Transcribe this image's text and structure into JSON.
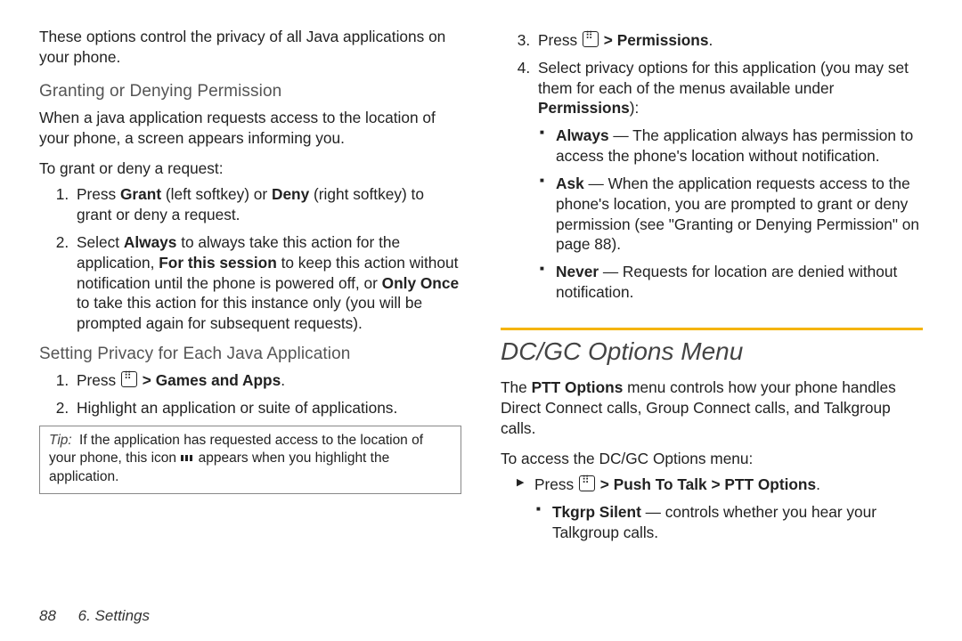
{
  "left": {
    "intro": "These options control the privacy of all Java applications on your phone.",
    "h_grant": "Granting or Denying Permission",
    "grant_body": "When a java application requests access to the location of your phone, a screen appears informing you.",
    "grant_lead": "To grant or deny a request:",
    "step1_a": "Press ",
    "step1_grant": "Grant",
    "step1_b": " (left softkey) or ",
    "step1_deny": "Deny",
    "step1_c": " (right softkey) to grant or deny a request.",
    "step2_a": "Select ",
    "step2_always": "Always",
    "step2_b": " to always take this action for the application, ",
    "step2_sess": "For this session",
    "step2_c": " to keep this action without notification until the phone is powered off, or ",
    "step2_once": "Only Once",
    "step2_d": " to take this action for this instance only (you will be prompted again for subsequent requests).",
    "h_priv": "Setting Privacy for Each Java Application",
    "priv1_a": "Press ",
    "priv1_path": "Games and Apps",
    "priv1_gt": " > ",
    "priv1_dot": ".",
    "priv2": "Highlight an application or suite of applications.",
    "tip_label": "Tip:",
    "tip_a": "If the application has requested access to the location of your phone, this icon ",
    "tip_b": " appears when you highlight the application."
  },
  "right": {
    "r3_a": "Press ",
    "r3_gt": " > ",
    "r3_perm": "Permissions",
    "r3_dot": ".",
    "r4_a": "Select privacy options for this application (you may set them for each of the menus available under ",
    "r4_perm": "Permissions",
    "r4_b": "):",
    "opt_always_l": "Always",
    "opt_always_t": " — The application always has permission to access the phone's location without notification.",
    "opt_ask_l": "Ask",
    "opt_ask_t": " — When the application requests access to the phone's location, you are prompted to grant or deny permission (see \"Granting or Denying Permission\" on page 88).",
    "opt_never_l": "Never",
    "opt_never_t": " — Requests for location are denied without notification.",
    "section": "DC/GC Options Menu",
    "dc_intro_a": "The ",
    "dc_intro_b": "PTT Options",
    "dc_intro_c": " menu controls how your phone handles Direct Connect calls, Group Connect calls, and Talkgroup calls.",
    "dc_lead": "To access the DC/GC Options menu:",
    "dc_press_a": "Press ",
    "dc_gt1": " > ",
    "dc_ptt": "Push To Talk",
    "dc_gt2": " > ",
    "dc_pttopt": "PTT Options",
    "dc_dot": ".",
    "dc_tk_l": "Tkgrp Silent",
    "dc_tk_t": " — controls whether you hear your Talkgroup calls."
  },
  "footer": {
    "page": "88",
    "chapter": "6. Settings"
  }
}
